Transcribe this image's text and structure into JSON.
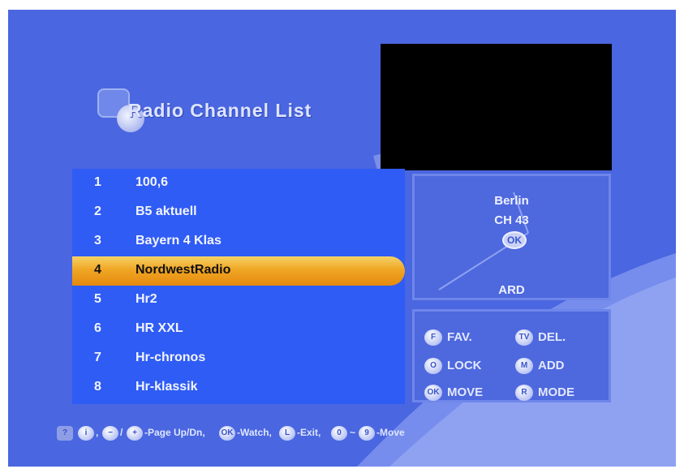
{
  "title": "Radio Channel List",
  "channels": [
    {
      "num": "1",
      "name": "100,6"
    },
    {
      "num": "2",
      "name": "B5 aktuell"
    },
    {
      "num": "3",
      "name": "Bayern 4 Klas"
    },
    {
      "num": "4",
      "name": "NordwestRadio"
    },
    {
      "num": "5",
      "name": "Hr2"
    },
    {
      "num": "6",
      "name": "HR XXL"
    },
    {
      "num": "7",
      "name": "Hr-chronos"
    },
    {
      "num": "8",
      "name": "Hr-klassik"
    }
  ],
  "selected_index": 3,
  "info": {
    "location": "Berlin",
    "channel": "CH 43",
    "ok_badge": "OK",
    "network": "ARD"
  },
  "keys": {
    "fav": {
      "btn": "F",
      "label": "FAV."
    },
    "del": {
      "btn": "TV",
      "label": "DEL."
    },
    "lock": {
      "btn": "O",
      "label": "LOCK"
    },
    "add": {
      "btn": "M",
      "label": "ADD"
    },
    "move": {
      "btn": "OK",
      "label": "MOVE"
    },
    "mode": {
      "btn": "R",
      "label": "MODE"
    }
  },
  "help": {
    "q": "?",
    "i": "i",
    "minus": "−",
    "plus": "+",
    "sep1": ",",
    "slash": "/",
    "page": "-Page Up/Dn,",
    "ok": "OK",
    "watch": "-Watch,",
    "l": "L",
    "exit": "-Exit,",
    "zero": "0",
    "tilde": "~",
    "nine": "9",
    "move": "-Move"
  },
  "colors": {
    "background": "#4a66e0",
    "list_bg": "#2f5cf4",
    "highlight": "#f0a624"
  }
}
